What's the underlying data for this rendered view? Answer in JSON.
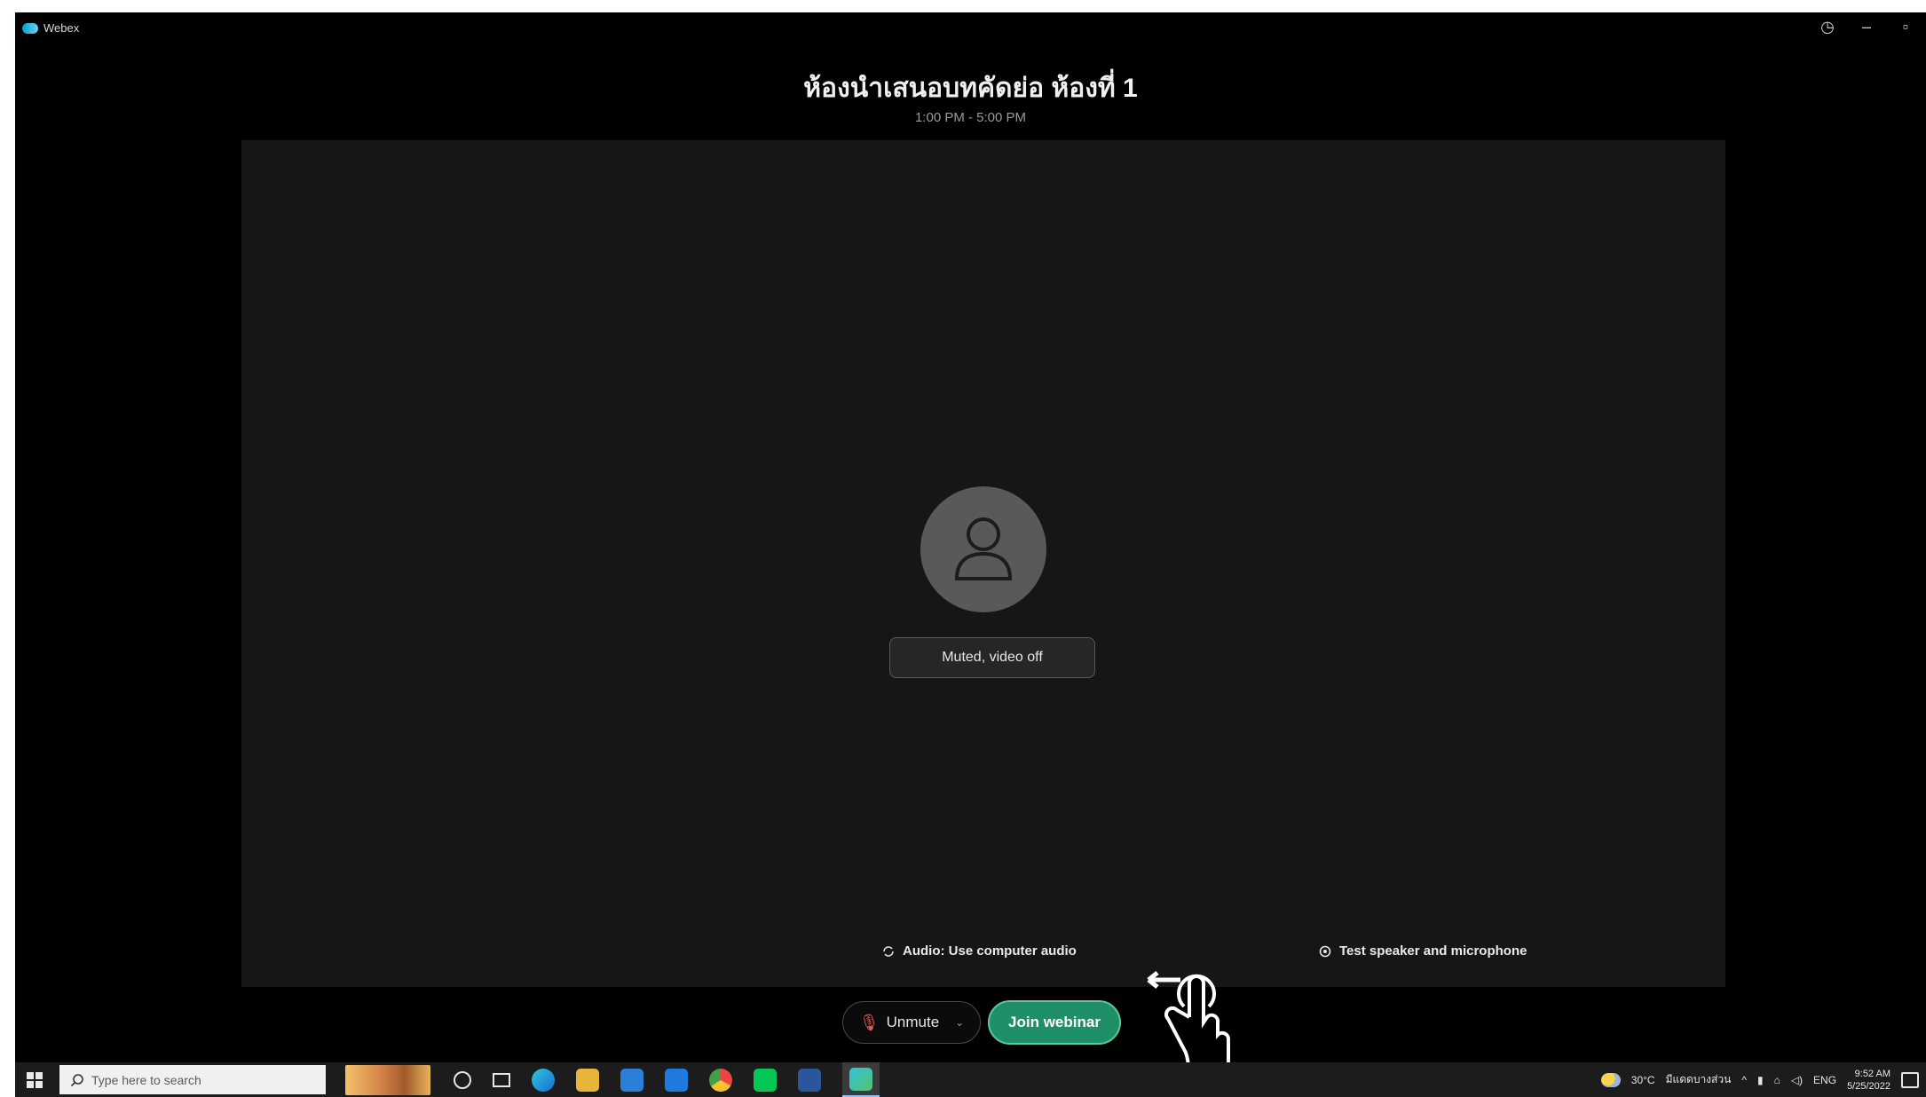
{
  "window": {
    "app_name": "Webex",
    "controls": [
      "◷",
      "–",
      "▫"
    ]
  },
  "meeting": {
    "title": "ห้องนำเสนอบทคัดย่อ ห้องที่ 1",
    "time": "1:00 PM - 5:00 PM"
  },
  "preview": {
    "status_text": "Muted, video off",
    "audio_option": "Audio: Use computer audio",
    "test_option": "Test speaker and microphone"
  },
  "controls": {
    "unmute_label": "Unmute",
    "join_label": "Join webinar"
  },
  "taskbar": {
    "search_placeholder": "Type here to search",
    "weather": "30°C",
    "weather_desc": "มีแดดบางส่วน",
    "language": "ENG",
    "time": "9:52 AM",
    "date": "5/25/2022"
  },
  "colors": {
    "join_button": "#1f8f67",
    "window_bg": "#000000",
    "preview_bg": "#161616"
  }
}
